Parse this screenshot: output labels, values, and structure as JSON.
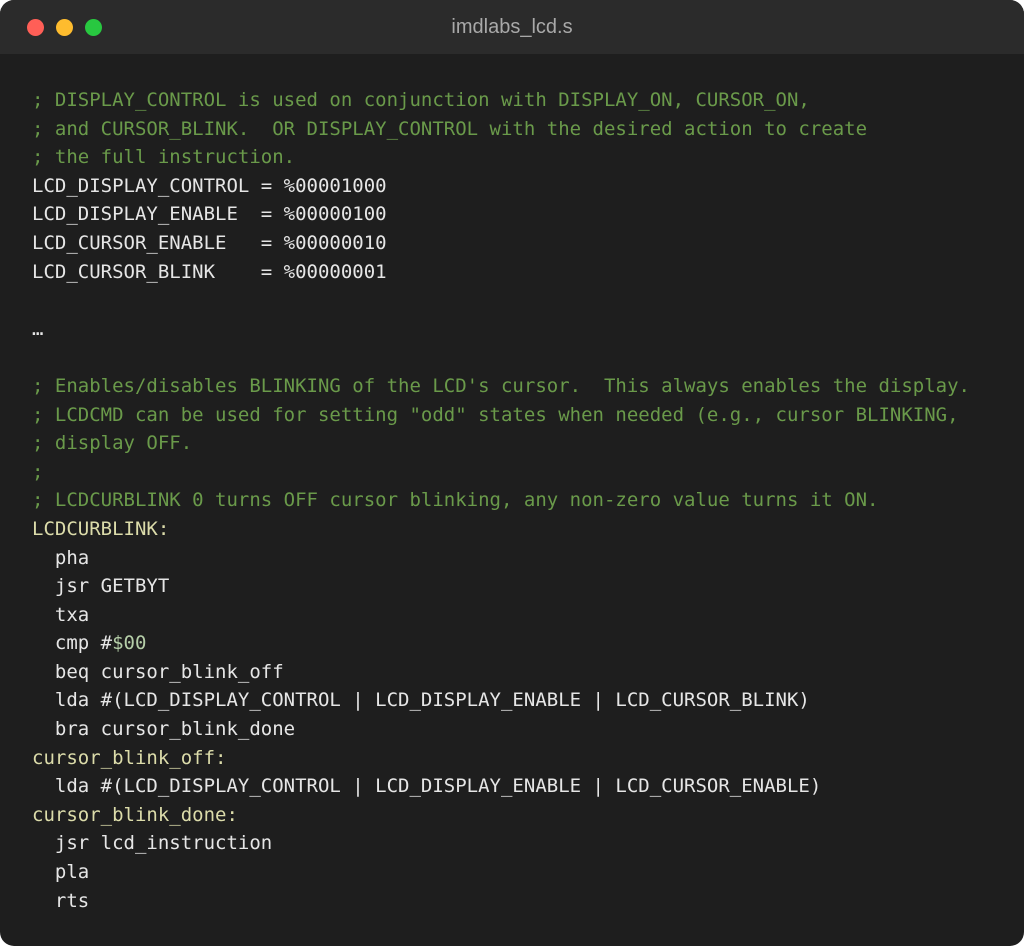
{
  "window": {
    "title": "imdlabs_lcd.s"
  },
  "colors": {
    "background": "#1e1e1e",
    "titlebar": "#2b2b2b",
    "comment": "#6a9a4a",
    "label": "#dcdcaa",
    "plain": "#e6e6e6",
    "number": "#b5cea8",
    "close": "#ff5f57",
    "minimize": "#febc2e",
    "zoom": "#28c840"
  },
  "code": {
    "lines": [
      [
        {
          "t": "; DISPLAY_CONTROL is used on conjunction with DISPLAY_ON, CURSOR_ON,",
          "c": "comment"
        }
      ],
      [
        {
          "t": "; and CURSOR_BLINK.  OR DISPLAY_CONTROL with the desired action to create",
          "c": "comment"
        }
      ],
      [
        {
          "t": "; the full instruction.",
          "c": "comment"
        }
      ],
      [
        {
          "t": "LCD_DISPLAY_CONTROL = %00001000",
          "c": "plain"
        }
      ],
      [
        {
          "t": "LCD_DISPLAY_ENABLE  = %00000100",
          "c": "plain"
        }
      ],
      [
        {
          "t": "LCD_CURSOR_ENABLE   = %00000010",
          "c": "plain"
        }
      ],
      [
        {
          "t": "LCD_CURSOR_BLINK    = %00000001",
          "c": "plain"
        }
      ],
      [],
      [
        {
          "t": "…",
          "c": "plain"
        }
      ],
      [],
      [
        {
          "t": "; Enables/disables BLINKING of the LCD's cursor.  This always enables the display.",
          "c": "comment"
        }
      ],
      [
        {
          "t": "; LCDCMD can be used for setting \"odd\" states when needed (e.g., cursor BLINKING,",
          "c": "comment"
        }
      ],
      [
        {
          "t": "; display OFF.",
          "c": "comment"
        }
      ],
      [
        {
          "t": ";",
          "c": "comment"
        }
      ],
      [
        {
          "t": "; LCDCURBLINK 0 turns OFF cursor blinking, any non-zero value turns it ON.",
          "c": "comment"
        }
      ],
      [
        {
          "t": "LCDCURBLINK:",
          "c": "label"
        }
      ],
      [
        {
          "t": "  pha",
          "c": "plain"
        }
      ],
      [
        {
          "t": "  jsr GETBYT",
          "c": "plain"
        }
      ],
      [
        {
          "t": "  txa",
          "c": "plain"
        }
      ],
      [
        {
          "t": "  cmp #",
          "c": "plain"
        },
        {
          "t": "$00",
          "c": "number"
        }
      ],
      [
        {
          "t": "  beq cursor_blink_off",
          "c": "plain"
        }
      ],
      [
        {
          "t": "  lda #(LCD_DISPLAY_CONTROL | LCD_DISPLAY_ENABLE | LCD_CURSOR_BLINK)",
          "c": "plain"
        }
      ],
      [
        {
          "t": "  bra cursor_blink_done",
          "c": "plain"
        }
      ],
      [
        {
          "t": "cursor_blink_off:",
          "c": "label"
        }
      ],
      [
        {
          "t": "  lda #(LCD_DISPLAY_CONTROL | LCD_DISPLAY_ENABLE | LCD_CURSOR_ENABLE)",
          "c": "plain"
        }
      ],
      [
        {
          "t": "cursor_blink_done:",
          "c": "label"
        }
      ],
      [
        {
          "t": "  jsr lcd_instruction",
          "c": "plain"
        }
      ],
      [
        {
          "t": "  pla",
          "c": "plain"
        }
      ],
      [
        {
          "t": "  rts",
          "c": "plain"
        }
      ]
    ]
  }
}
